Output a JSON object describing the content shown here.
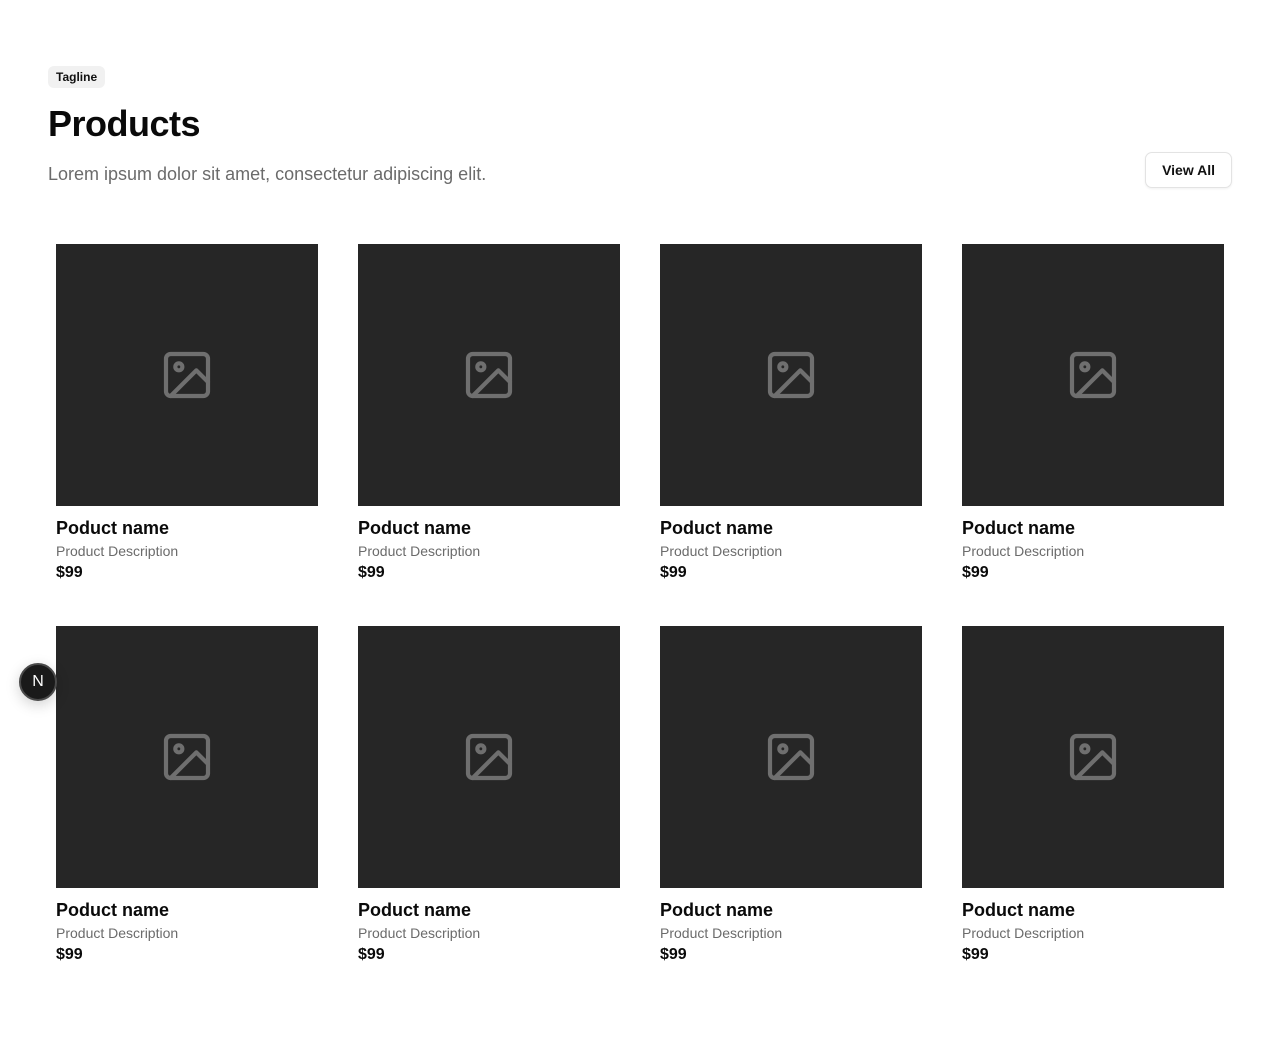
{
  "header": {
    "tagline": "Tagline",
    "title": "Products",
    "subtitle": "Lorem ipsum dolor sit amet, consectetur adipiscing elit.",
    "view_all_label": "View All"
  },
  "products": [
    {
      "name": "Poduct name",
      "description": "Product Description",
      "price": "$99",
      "image_icon": "image-icon"
    },
    {
      "name": "Poduct name",
      "description": "Product Description",
      "price": "$99",
      "image_icon": "image-icon"
    },
    {
      "name": "Poduct name",
      "description": "Product Description",
      "price": "$99",
      "image_icon": "image-icon"
    },
    {
      "name": "Poduct name",
      "description": "Product Description",
      "price": "$99",
      "image_icon": "image-icon"
    },
    {
      "name": "Poduct name",
      "description": "Product Description",
      "price": "$99",
      "image_icon": "image-icon"
    },
    {
      "name": "Poduct name",
      "description": "Product Description",
      "price": "$99",
      "image_icon": "image-icon"
    },
    {
      "name": "Poduct name",
      "description": "Product Description",
      "price": "$99",
      "image_icon": "image-icon"
    },
    {
      "name": "Poduct name",
      "description": "Product Description",
      "price": "$99",
      "image_icon": "image-icon"
    }
  ],
  "floating_badge": {
    "label": "N",
    "icon": "nextjs-devtools-icon"
  },
  "colors": {
    "thumbnail_bg": "#262626",
    "placeholder_icon": "#6f6f6f",
    "muted_text": "#6b6b6b",
    "tagline_bg": "#f1f1f1"
  }
}
